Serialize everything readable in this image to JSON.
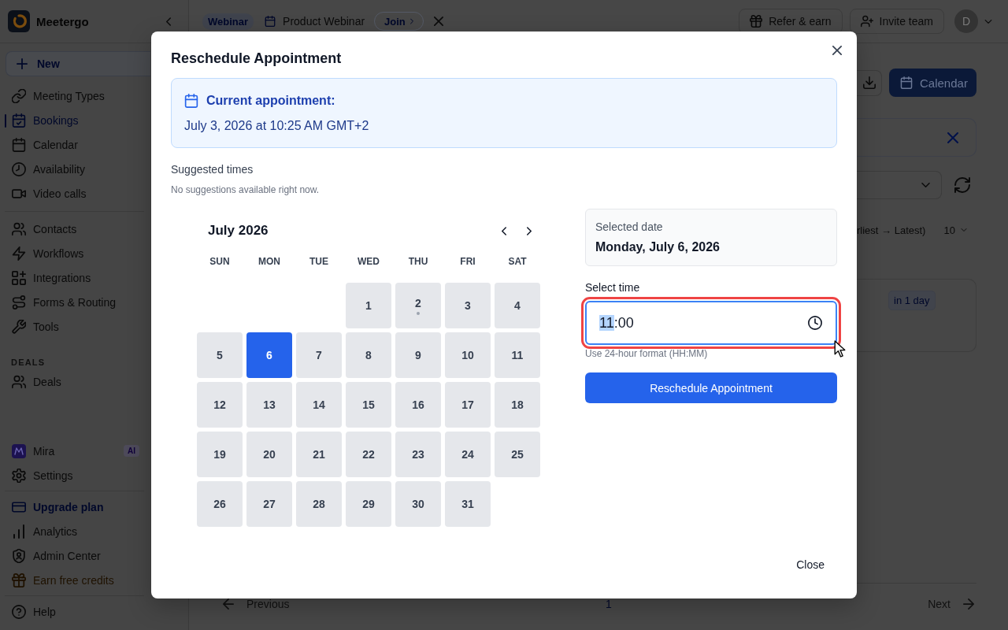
{
  "sidebar": {
    "brand": "Meetergo",
    "new_button": "New",
    "nav_groups": [
      {
        "items": [
          {
            "label": "Meeting Types",
            "kind": "nav",
            "selected": false
          },
          {
            "label": "Bookings",
            "kind": "nav",
            "selected": true
          },
          {
            "label": "Calendar",
            "kind": "nav",
            "selected": false
          },
          {
            "label": "Availability",
            "kind": "nav",
            "selected": false
          },
          {
            "label": "Video calls",
            "kind": "nav",
            "selected": false
          }
        ]
      },
      {
        "items": [
          {
            "label": "Contacts",
            "kind": "nav",
            "selected": false
          },
          {
            "label": "Workflows",
            "kind": "nav",
            "selected": false
          },
          {
            "label": "Integrations",
            "kind": "nav",
            "selected": false
          },
          {
            "label": "Forms & Routing",
            "kind": "nav",
            "selected": false
          },
          {
            "label": "Tools",
            "kind": "nav",
            "selected": false
          }
        ]
      },
      {
        "heading": "DEALS",
        "items": [
          {
            "label": "Deals",
            "kind": "nav",
            "selected": false
          }
        ]
      }
    ],
    "bottom_groups": [
      {
        "items": [
          {
            "label": "Mira",
            "kind": "nav",
            "badge": "AI",
            "selected": false
          },
          {
            "label": "Settings",
            "kind": "nav",
            "selected": false
          }
        ]
      },
      {
        "items": [
          {
            "label": "Upgrade plan",
            "kind": "upgrade",
            "selected": false
          },
          {
            "label": "Analytics",
            "kind": "nav",
            "selected": false
          },
          {
            "label": "Admin Center",
            "kind": "nav",
            "selected": false
          },
          {
            "label": "Earn free credits",
            "kind": "promo",
            "selected": false
          }
        ]
      },
      {
        "items": [
          {
            "label": "Help",
            "kind": "nav",
            "selected": false
          }
        ]
      }
    ]
  },
  "top_bar": {
    "event_badge": "Webinar",
    "event_title": "Product Webinar",
    "join_button": "Join",
    "buttons": [
      {
        "label": "Refer & earn"
      },
      {
        "label": "Invite team"
      }
    ],
    "avatar_initial": "D"
  },
  "bookings": {
    "calendar_button": "Calendar",
    "sort_label": "rliest → Latest)",
    "page_size": "10",
    "booking_badge": "in 1 day"
  },
  "pagination": {
    "previous": "Previous",
    "pages": [
      {
        "label": "1",
        "selected": true
      }
    ],
    "next": "Next"
  },
  "modal": {
    "title": "Reschedule Appointment",
    "current_appointment": {
      "heading": "Current appointment:",
      "value": "July 3, 2026 at 10:25 AM GMT+2"
    },
    "suggested_times": {
      "heading": "Suggested times",
      "empty_text": "No suggestions available right now."
    },
    "calendar": {
      "month": "July 2026",
      "weekdays": [
        "SUN",
        "MON",
        "TUE",
        "WED",
        "THU",
        "FRI",
        "SAT"
      ],
      "cells": [
        {
          "kind": "blank"
        },
        {
          "kind": "blank"
        },
        {
          "kind": "blank"
        },
        {
          "kind": "day",
          "label": "1",
          "selected": false,
          "marked": false
        },
        {
          "kind": "day",
          "label": "2",
          "selected": false,
          "marked": true
        },
        {
          "kind": "day",
          "label": "3",
          "selected": false,
          "marked": false
        },
        {
          "kind": "day",
          "label": "4",
          "selected": false,
          "marked": false
        },
        {
          "kind": "day",
          "label": "5",
          "selected": false,
          "marked": false
        },
        {
          "kind": "day",
          "label": "6",
          "selected": true,
          "marked": false
        },
        {
          "kind": "day",
          "label": "7",
          "selected": false,
          "marked": false
        },
        {
          "kind": "day",
          "label": "8",
          "selected": false,
          "marked": false
        },
        {
          "kind": "day",
          "label": "9",
          "selected": false,
          "marked": false
        },
        {
          "kind": "day",
          "label": "10",
          "selected": false,
          "marked": false
        },
        {
          "kind": "day",
          "label": "11",
          "selected": false,
          "marked": false
        },
        {
          "kind": "day",
          "label": "12",
          "selected": false,
          "marked": false
        },
        {
          "kind": "day",
          "label": "13",
          "selected": false,
          "marked": false
        },
        {
          "kind": "day",
          "label": "14",
          "selected": false,
          "marked": false
        },
        {
          "kind": "day",
          "label": "15",
          "selected": false,
          "marked": false
        },
        {
          "kind": "day",
          "label": "16",
          "selected": false,
          "marked": false
        },
        {
          "kind": "day",
          "label": "17",
          "selected": false,
          "marked": false
        },
        {
          "kind": "day",
          "label": "18",
          "selected": false,
          "marked": false
        },
        {
          "kind": "day",
          "label": "19",
          "selected": false,
          "marked": false
        },
        {
          "kind": "day",
          "label": "20",
          "selected": false,
          "marked": false
        },
        {
          "kind": "day",
          "label": "21",
          "selected": false,
          "marked": false
        },
        {
          "kind": "day",
          "label": "22",
          "selected": false,
          "marked": false
        },
        {
          "kind": "day",
          "label": "23",
          "selected": false,
          "marked": false
        },
        {
          "kind": "day",
          "label": "24",
          "selected": false,
          "marked": false
        },
        {
          "kind": "day",
          "label": "25",
          "selected": false,
          "marked": false
        },
        {
          "kind": "day",
          "label": "26",
          "selected": false,
          "marked": false
        },
        {
          "kind": "day",
          "label": "27",
          "selected": false,
          "marked": false
        },
        {
          "kind": "day",
          "label": "28",
          "selected": false,
          "marked": false
        },
        {
          "kind": "day",
          "label": "29",
          "selected": false,
          "marked": false
        },
        {
          "kind": "day",
          "label": "30",
          "selected": false,
          "marked": false
        },
        {
          "kind": "day",
          "label": "31",
          "selected": false,
          "marked": false
        }
      ]
    },
    "selected_date": {
      "label": "Selected date",
      "value": "Monday, July 6, 2026"
    },
    "time": {
      "label": "Select time",
      "focused": true,
      "segments": [
        {
          "kind": "number",
          "text": "11",
          "selected": true
        },
        {
          "kind": "separator",
          "text": ":"
        },
        {
          "kind": "number",
          "text": "00",
          "selected": false
        }
      ],
      "hint": "Use 24-hour format (HH:MM)"
    },
    "submit_button": "Reschedule Appointment",
    "close_button": "Close"
  }
}
